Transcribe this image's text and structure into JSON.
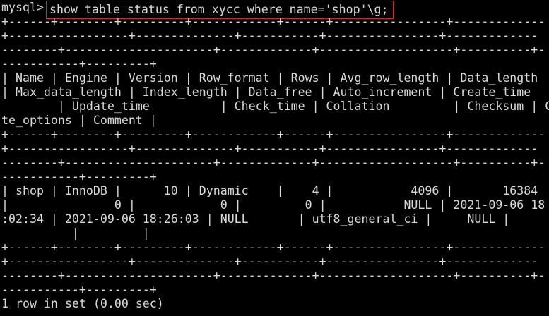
{
  "terminal": {
    "prompt": "mysql>",
    "command": "show table status from xycc where name='shop'\\g;",
    "highlight_color": "#e0222a",
    "text_color": "#d9d9d9",
    "background_color": "#000000",
    "lines": [
      "+------+--------+---------+------------+------+----------------+-------------",
      "+-----------------+--------------+-----------+----------------+-------------",
      "--------+---------------------+-------------+-------------------+----------+-",
      "-----------+---------+",
      "| Name | Engine | Version | Row_format | Rows | Avg_row_length | Data_length",
      "| Max_data_length | Index_length | Data_free | Auto_increment | Create_time",
      "        | Update_time          | Check_time | Collation         | Checksum | Crea",
      "te_options | Comment |",
      "+------+--------+---------+------------+------+----------------+-------------",
      "+-----------------+--------------+-----------+----------------+-------------",
      "--------+---------------------+-------------+-------------------+----------+-",
      "-----------+---------+",
      "| shop | InnoDB |      10 | Dynamic    |    4 |           4096 |       16384",
      "|               0 |            0 |         0 |           NULL | 2021-09-06 18",
      ":02:34 | 2021-09-06 18:26:03 | NULL       | utf8_general_ci |     NULL |",
      "          |         |",
      "+------+--------+---------+------------+------+----------------+-------------",
      "+-----------------+--------------+-----------+----------------+-------------",
      "--------+---------------------+-------------+-------------------+----------+-",
      "-----------+---------+",
      "1 row in set (0.00 sec)"
    ]
  }
}
